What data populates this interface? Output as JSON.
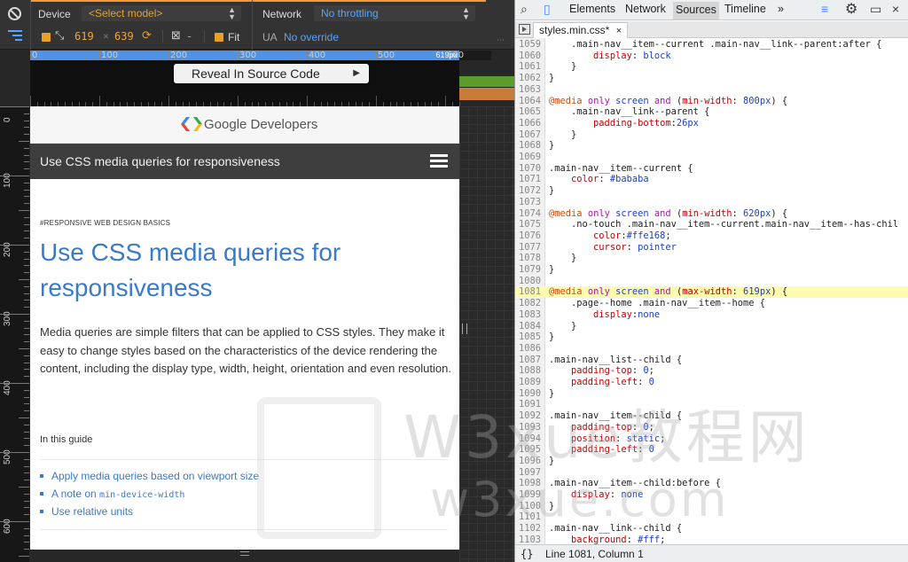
{
  "device_toolbar": {
    "device_label": "Device",
    "model_select": "<Select model>",
    "network_label": "Network",
    "network_select": "No throttling",
    "width_value": "619",
    "times_sign": "×",
    "height_value": "639",
    "scale_dash": "-",
    "fit_label": "Fit",
    "ua_label": "UA",
    "ua_value": "No override",
    "accent_color": "#f59a3b"
  },
  "ruler": {
    "h_ticks": [
      "0",
      "100",
      "200",
      "300",
      "400",
      "500",
      "600"
    ],
    "px_readout": "619px",
    "v_ticks": [
      "0",
      "100",
      "200",
      "300",
      "400",
      "500",
      "600"
    ]
  },
  "context_menu": {
    "reveal_label": "Reveal In Source Code"
  },
  "page": {
    "brand": "Google Developers",
    "nav_title": "Use CSS media queries for responsiveness",
    "eyebrow": "#RESPONSIVE WEB DESIGN BASICS",
    "heading": "Use CSS media queries for responsiveness",
    "lead": "Media queries are simple filters that can be applied to CSS styles. They make it easy to change styles based on the characteristics of the device rendering the content, including the display type, width, height, orientation and even resolution.",
    "in_this_guide": "In this guide",
    "toc": [
      {
        "text": "Apply media queries based on viewport size"
      },
      {
        "prefix": "A note on ",
        "code": "min-device-width"
      },
      {
        "text": "Use relative units"
      }
    ]
  },
  "devtools": {
    "tabs": [
      "Elements",
      "Network",
      "Sources",
      "Timeline"
    ],
    "active_tab": "Sources",
    "more_tabs": "»",
    "file_tab": "styles.min.css*",
    "close_glyph": "×",
    "status_braces": "{}",
    "status_position": "Line 1081, Column 1",
    "highlight_line": "1081",
    "lines": [
      {
        "n": "1059",
        "t": "    .main-nav__item--current .main-nav__link--parent:after {"
      },
      {
        "n": "1060",
        "t": "        display: block"
      },
      {
        "n": "1061",
        "t": "    }"
      },
      {
        "n": "1062",
        "t": "}"
      },
      {
        "n": "1063",
        "t": ""
      },
      {
        "n": "1064",
        "t": "@media only screen and (min-width: 800px) {"
      },
      {
        "n": "1065",
        "t": "    .main-nav__link--parent {"
      },
      {
        "n": "1066",
        "t": "        padding-bottom:26px"
      },
      {
        "n": "1067",
        "t": "    }"
      },
      {
        "n": "1068",
        "t": "}"
      },
      {
        "n": "1069",
        "t": ""
      },
      {
        "n": "1070",
        "t": ".main-nav__item--current {"
      },
      {
        "n": "1071",
        "t": "    color: #bababa"
      },
      {
        "n": "1072",
        "t": "}"
      },
      {
        "n": "1073",
        "t": ""
      },
      {
        "n": "1074",
        "t": "@media only screen and (min-width: 620px) {"
      },
      {
        "n": "1075",
        "t": "    .no-touch .main-nav__item--current.main-nav__item--has-chil"
      },
      {
        "n": "1076",
        "t": "        color:#ffe168;"
      },
      {
        "n": "1077",
        "t": "        cursor: pointer"
      },
      {
        "n": "1078",
        "t": "    }"
      },
      {
        "n": "1079",
        "t": "}"
      },
      {
        "n": "1080",
        "t": ""
      },
      {
        "n": "1081",
        "t": "@media only screen and (max-width: 619px) {"
      },
      {
        "n": "1082",
        "t": "    .page--home .main-nav__item--home {"
      },
      {
        "n": "1083",
        "t": "        display:none"
      },
      {
        "n": "1084",
        "t": "    }"
      },
      {
        "n": "1085",
        "t": "}"
      },
      {
        "n": "1086",
        "t": ""
      },
      {
        "n": "1087",
        "t": ".main-nav__list--child {"
      },
      {
        "n": "1088",
        "t": "    padding-top: 0;"
      },
      {
        "n": "1089",
        "t": "    padding-left: 0"
      },
      {
        "n": "1090",
        "t": "}"
      },
      {
        "n": "1091",
        "t": ""
      },
      {
        "n": "1092",
        "t": ".main-nav__item--child {"
      },
      {
        "n": "1093",
        "t": "    padding-top: 0;"
      },
      {
        "n": "1094",
        "t": "    position: static;"
      },
      {
        "n": "1095",
        "t": "    padding-left: 0"
      },
      {
        "n": "1096",
        "t": "}"
      },
      {
        "n": "1097",
        "t": ""
      },
      {
        "n": "1098",
        "t": ".main-nav__item--child:before {"
      },
      {
        "n": "1099",
        "t": "    display: none"
      },
      {
        "n": "1100",
        "t": "}"
      },
      {
        "n": "1101",
        "t": ""
      },
      {
        "n": "1102",
        "t": ".main-nav__link--child {"
      },
      {
        "n": "1103",
        "t": "    background: #fff;"
      }
    ]
  },
  "watermark": {
    "text": "W3xue教程网",
    "url": "w3xue.com"
  },
  "icons": {
    "block": "no-entry-icon",
    "media_queries": "media-query-icon",
    "swap": "swap-dimensions-icon",
    "inspect": "inspect-icon",
    "device": "device-mode-icon",
    "console": "console-drawer-icon",
    "settings": "gear-icon",
    "dock": "dock-icon",
    "close": "close-icon"
  }
}
